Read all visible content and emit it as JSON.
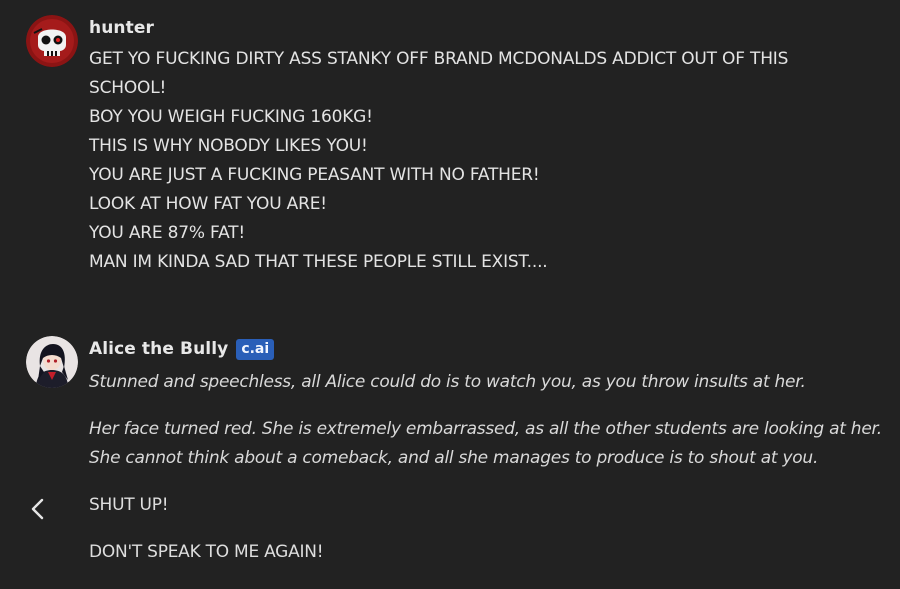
{
  "messages": [
    {
      "author": "hunter",
      "avatar_icon": "skull-avatar-icon",
      "lines": [
        "GET YO FUCKING DIRTY ASS STANKY OFF BRAND MCDONALDS ADDICT OUT OF THIS",
        "SCHOOL!",
        "BOY YOU WEIGH FUCKING 160KG!",
        "THIS IS WHY NOBODY LIKES YOU!",
        "YOU ARE JUST A FUCKING PEASANT WITH NO FATHER!",
        "LOOK AT HOW FAT YOU ARE!",
        "YOU ARE 87% FAT!",
        "MAN IM KINDA SAD THAT THESE PEOPLE STILL EXIST...."
      ]
    },
    {
      "author": "Alice the Bully",
      "badge": "c.ai",
      "avatar_icon": "anime-character-avatar-icon",
      "paragraphs": [
        {
          "text": "Stunned and speechless, all Alice could do is to watch you, as you throw insults at her.",
          "style": "italic"
        },
        {
          "text": "Her face turned red. She is extremely embarrassed, as all the other students are looking at her.",
          "style": "italic"
        },
        {
          "text": "She cannot think about a comeback, and all she manages to produce is to shout at you.",
          "style": "italic"
        },
        {
          "text": "SHUT UP!",
          "style": "normal"
        },
        {
          "text": "DON'T SPEAK TO ME AGAIN!",
          "style": "normal"
        }
      ]
    }
  ],
  "controls": {
    "back_icon": "chevron-left-icon"
  },
  "colors": {
    "background": "#222222",
    "text": "#e3e3e3",
    "badge": "#2a5fb8"
  }
}
